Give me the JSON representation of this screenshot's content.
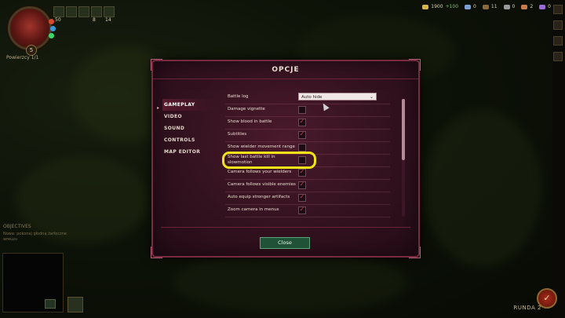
{
  "hud": {
    "portrait_level": "5",
    "portrait_caption": "Powierzcy 1/1",
    "stats": [
      "50",
      "8",
      "14"
    ],
    "resources": [
      {
        "icon": "gold-icon",
        "value": "1900",
        "delta": "+100",
        "color": "#d8b34a"
      },
      {
        "icon": "mana-icon",
        "value": "0",
        "color": "#7aa0d8"
      },
      {
        "icon": "wood-icon",
        "value": "11",
        "color": "#8a6a3a"
      },
      {
        "icon": "stone-icon",
        "value": "0",
        "color": "#9a9a9a"
      },
      {
        "icon": "ore-icon",
        "value": "2",
        "color": "#c87a4a"
      },
      {
        "icon": "crystal-icon",
        "value": "0",
        "color": "#9a6ad8"
      }
    ],
    "objectives_title": "OBJECTIVES",
    "objectives_line1": "Nowa: pokonaj głodną żarłoczne",
    "objectives_line2": "wreuzu",
    "round_label": "RUNDA 2"
  },
  "dialog": {
    "title": "OPCJE",
    "tabs": [
      {
        "label": "GAMEPLAY",
        "active": true
      },
      {
        "label": "VIDEO",
        "active": false
      },
      {
        "label": "SOUND",
        "active": false
      },
      {
        "label": "CONTROLS",
        "active": false
      },
      {
        "label": "MAP EDITOR",
        "active": false
      }
    ],
    "settings": [
      {
        "label": "Battle log",
        "type": "select",
        "value": "Auto hide"
      },
      {
        "label": "Damage vignette",
        "type": "checkbox",
        "checked": false
      },
      {
        "label": "Show blood in battle",
        "type": "checkbox",
        "checked": true
      },
      {
        "label": "Subtitles",
        "type": "checkbox",
        "checked": true
      },
      {
        "label": "Show wielder movement range",
        "type": "checkbox",
        "checked": false
      },
      {
        "label": "Show last battle kill in slowmotion",
        "type": "checkbox",
        "checked": false
      },
      {
        "label": "Camera follows your wielders",
        "type": "checkbox",
        "checked": true
      },
      {
        "label": "Camera follows visible enemies",
        "type": "checkbox",
        "checked": true
      },
      {
        "label": "Auto equip stronger artifacts",
        "type": "checkbox",
        "checked": true
      },
      {
        "label": "Zoom camera in menus",
        "type": "checkbox",
        "checked": true
      }
    ],
    "close_label": "Close"
  },
  "colors": {
    "dialog_bg": "#33121f",
    "dialog_border": "#7a2a40",
    "highlight": "#f2e21a",
    "checkmark": "#e03a4a",
    "close_button": "#1f5236"
  }
}
